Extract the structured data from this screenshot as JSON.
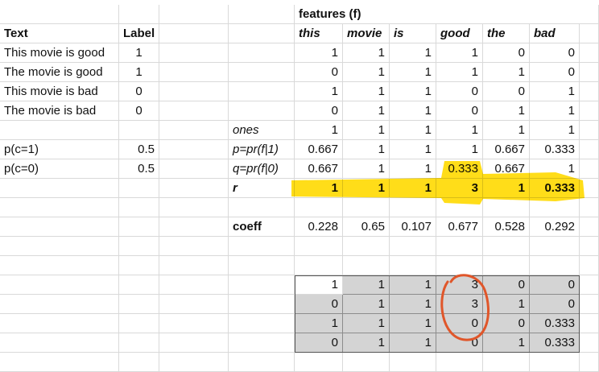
{
  "sheet": {
    "features_header": "features (f)",
    "col_text_header": "Text",
    "col_label_header": "Label",
    "feature_names": [
      "this",
      "movie",
      "is",
      "good",
      "the",
      "bad"
    ],
    "docs": [
      {
        "text": "This movie is good",
        "label": "1",
        "f": [
          "1",
          "1",
          "1",
          "1",
          "0",
          "0"
        ]
      },
      {
        "text": "The movie is good",
        "label": "1",
        "f": [
          "0",
          "1",
          "1",
          "1",
          "1",
          "0"
        ]
      },
      {
        "text": "This movie is bad",
        "label": "0",
        "f": [
          "1",
          "1",
          "1",
          "0",
          "0",
          "1"
        ]
      },
      {
        "text": "The movie is bad",
        "label": "0",
        "f": [
          "0",
          "1",
          "1",
          "0",
          "1",
          "1"
        ]
      }
    ],
    "ones": {
      "name": "ones",
      "values": [
        "1",
        "1",
        "1",
        "1",
        "1",
        "1"
      ]
    },
    "pc1": {
      "name": "p(c=1)",
      "value": "0.5"
    },
    "pc0": {
      "name": "p(c=0)",
      "value": "0.5"
    },
    "p_row": {
      "name": "p=pr(f|1)",
      "values": [
        "0.667",
        "1",
        "1",
        "1",
        "0.667",
        "0.333"
      ]
    },
    "q_row": {
      "name": "q=pr(f|0)",
      "values": [
        "0.667",
        "1",
        "1",
        "0.333",
        "0.667",
        "1"
      ]
    },
    "r_row": {
      "name": "r",
      "values": [
        "1",
        "1",
        "1",
        "3",
        "1",
        "0.333"
      ]
    },
    "coeff": {
      "name": "coeff",
      "values": [
        "0.228",
        "0.65",
        "0.107",
        "0.677",
        "0.528",
        "0.292"
      ]
    },
    "weighted": [
      [
        "1",
        "1",
        "1",
        "3",
        "0",
        "0"
      ],
      [
        "0",
        "1",
        "1",
        "3",
        "1",
        "0"
      ],
      [
        "1",
        "1",
        "1",
        "0",
        "0",
        "0.333"
      ],
      [
        "0",
        "1",
        "1",
        "0",
        "1",
        "0.333"
      ]
    ]
  },
  "colors": {
    "highlight": "#ffd900",
    "circle": "#e0562a",
    "shade": "#d4d4d4",
    "gridline": "#d9d9d9"
  }
}
